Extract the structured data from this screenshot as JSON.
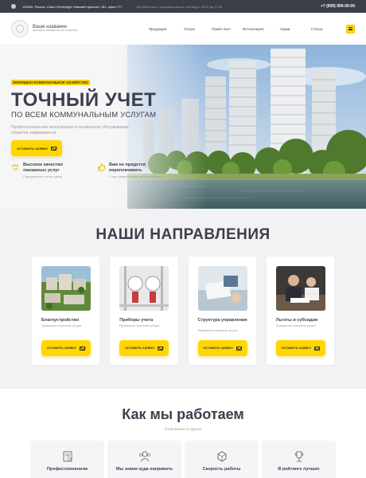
{
  "topbar": {
    "address": "190040, Россия, Санкт-Петербург, Невский проспект, 161, офис 777",
    "work_hours": "Мы работаем с понедельника по пятницу с 09:00 до 17:00",
    "phone": "+7 (000) 000-00-00",
    "location_icon": "location-pin-icon"
  },
  "header": {
    "brand_name": "Ваше название",
    "brand_tagline": "жилищно-коммунальное хозяйство",
    "nav": [
      "Продукция",
      "Услуги",
      "Прайс-лист",
      "Фотогалерея",
      "Акции",
      "Статьи"
    ],
    "menu_icon": "hamburger-icon"
  },
  "hero": {
    "tag": "ЖИЛИЩНО-КОММУНАЛЬНОЕ ХОЗЯЙСТВО",
    "title": "ТОЧНЫЙ УЧЕТ",
    "subtitle": "ПО ВСЕМ КОММУНАЛЬНЫМ УСЛУГАМ",
    "description": "Профессиональная эксплуатация и техническое обслуживание объектов недвижимости",
    "cta": "ОСТАВИТЬ ЗАЯВКУ",
    "features": [
      {
        "title": "Высокое качество оказанных услуг",
        "desc": "Специалисты своего дела",
        "icon": "handshake-icon"
      },
      {
        "title": "Вам не придется переплачивать",
        "desc": "У нас самые низкие цены на рынке",
        "icon": "thumbs-up-icon"
      }
    ]
  },
  "directions": {
    "title": "НАШИ НАПРАВЛЕНИЯ",
    "cards": [
      {
        "title": "Благоустройство",
        "desc": "Примерное описание услуги",
        "button": "ОСТАВИТЬ ЗАЯВКУ"
      },
      {
        "title": "Приборы учета",
        "desc": "Примерное описание услуги",
        "button": "ОСТАВИТЬ ЗАЯВКУ"
      },
      {
        "title": "Структура управления",
        "desc": "Примерное описание услуги",
        "button": "ОСТАВИТЬ ЗАЯВКУ"
      },
      {
        "title": "Льготы и субсидии",
        "desc": "Примерное описание услуги",
        "button": "ОСТАВИТЬ ЗАЯВКУ"
      }
    ]
  },
  "how": {
    "title": "Как мы работаем",
    "subtitle": "Отличаемся от других",
    "cards": [
      {
        "title": "Профессионализм",
        "icon": "certificate-icon"
      },
      {
        "title": "Мы знаем куда направить",
        "icon": "manager-icon"
      },
      {
        "title": "Скорость работы",
        "icon": "box-icon"
      },
      {
        "title": "В рейтинге лучших",
        "icon": "trophy-icon"
      }
    ]
  },
  "colors": {
    "accent": "#ffd600",
    "dark": "#3b3d49",
    "text": "#3e3e4e"
  }
}
